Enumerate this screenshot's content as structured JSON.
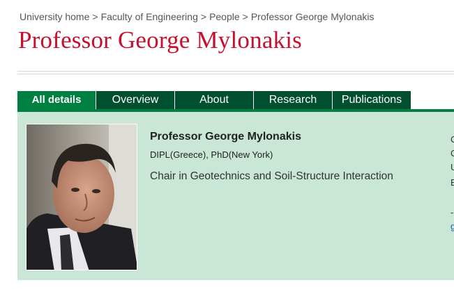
{
  "breadcrumb": {
    "items": [
      "University home",
      "Faculty of Engineering",
      "People",
      "Professor George Mylonakis"
    ],
    "separator": ">"
  },
  "page_title": "Professor George Mylonakis",
  "tabs": [
    {
      "label": "All details",
      "active": true
    },
    {
      "label": "Overview",
      "active": false
    },
    {
      "label": "About",
      "active": false
    },
    {
      "label": "Research",
      "active": false
    },
    {
      "label": "Publications",
      "active": false
    }
  ],
  "profile": {
    "name": "Professor George Mylonakis",
    "qualifications": "DIPL(Greece), PhD(New York)",
    "role": "Chair in Geotechnics and Soil-Structure Interaction"
  },
  "contact_clipped": {
    "lines": [
      "C",
      "C",
      "U",
      "E"
    ],
    "dash": "-",
    "link_fragment": "g"
  },
  "colors": {
    "title_red": "#c8102e",
    "tab_dark_green": "#005030",
    "tab_active_green": "#008040",
    "panel_green": "#c9e6d6"
  }
}
